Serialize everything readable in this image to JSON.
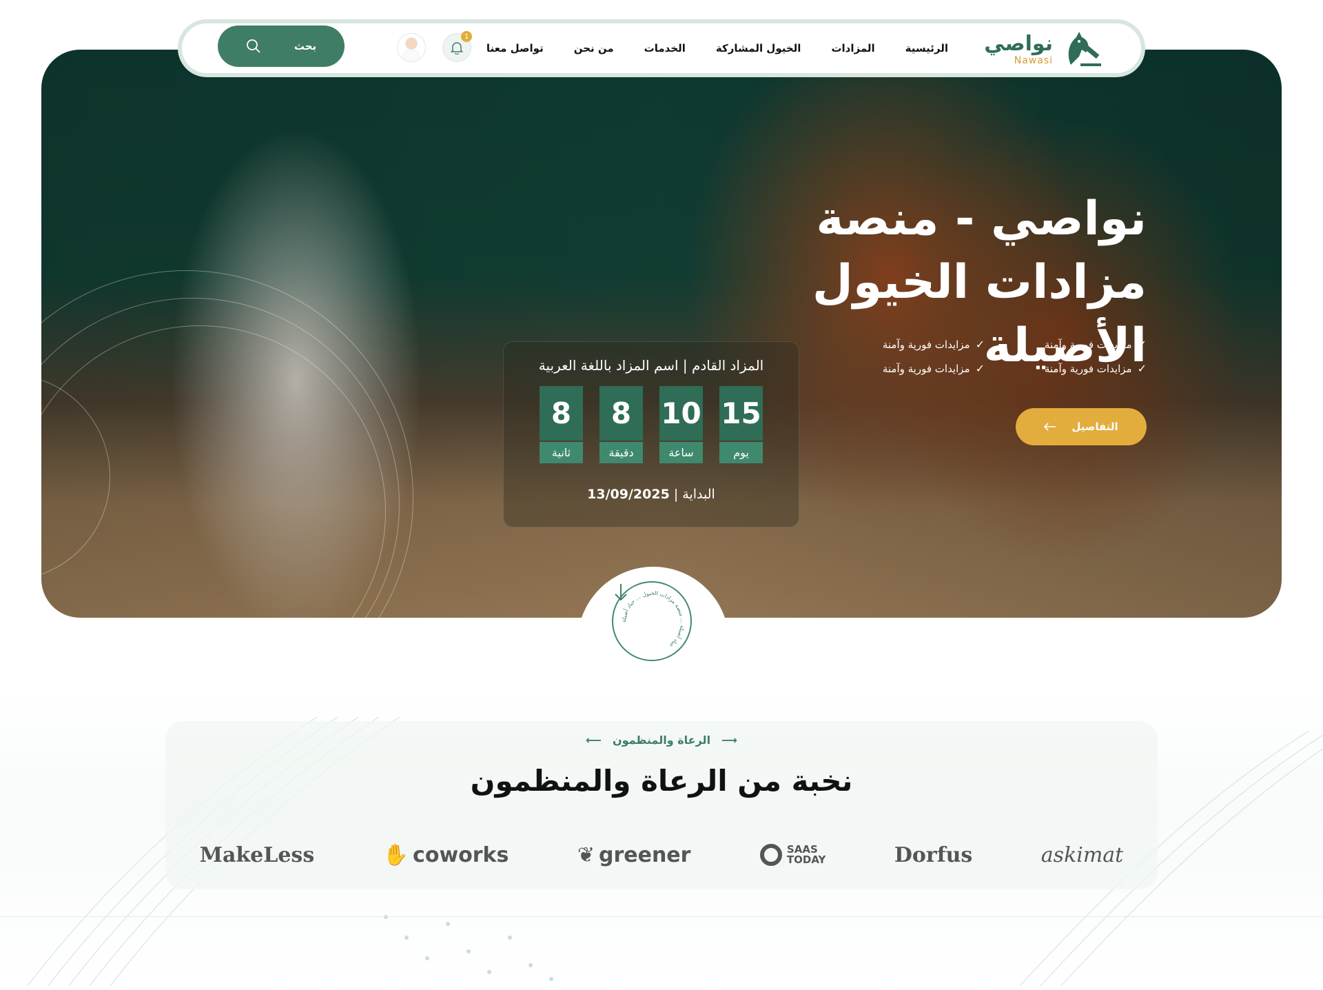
{
  "nav": {
    "logo_ar": "نواصي",
    "logo_en": "Nawasi",
    "links": [
      "الرئيسية",
      "المزادات",
      "الخيول المشاركة",
      "الخدمات",
      "من نحن",
      "تواصل معنا"
    ],
    "notification_count": "1",
    "search_label": "بحث"
  },
  "hero": {
    "title": "نواصي - منصة مزادات الخيول الأصيلة",
    "features": [
      "مزايدات فورية وآمنة",
      "مزايدات فورية وآمنة",
      "مزايدات فورية وآمنة",
      "مزايدات فورية وآمنة"
    ],
    "details_label": "التفاصيل",
    "countdown": {
      "next_label": "المزاد القادم | اسم المزاد باللغة العربية",
      "units": [
        {
          "value": "15",
          "label": "يوم"
        },
        {
          "value": "10",
          "label": "ساعة"
        },
        {
          "value": "8",
          "label": "دقيقة"
        },
        {
          "value": "8",
          "label": "ثانية"
        }
      ],
      "start_label": "البداية |",
      "start_date": "13/09/2025"
    },
    "badge_text": "جياد أصيلة ... منصة مزادات الخيول ... جياد أصيلة"
  },
  "sponsors": {
    "eyebrow": "الرعاة والمنظمون",
    "title": "نخبة من الرعاة والمنظمون",
    "logos": [
      "askimat",
      "Dorfus",
      "SAAS",
      "TODAY",
      "greener",
      "coworks",
      "MakeLess"
    ]
  },
  "colors": {
    "primary": "#3f7e64",
    "accent": "#e2ad3c",
    "dark": "#111111"
  }
}
